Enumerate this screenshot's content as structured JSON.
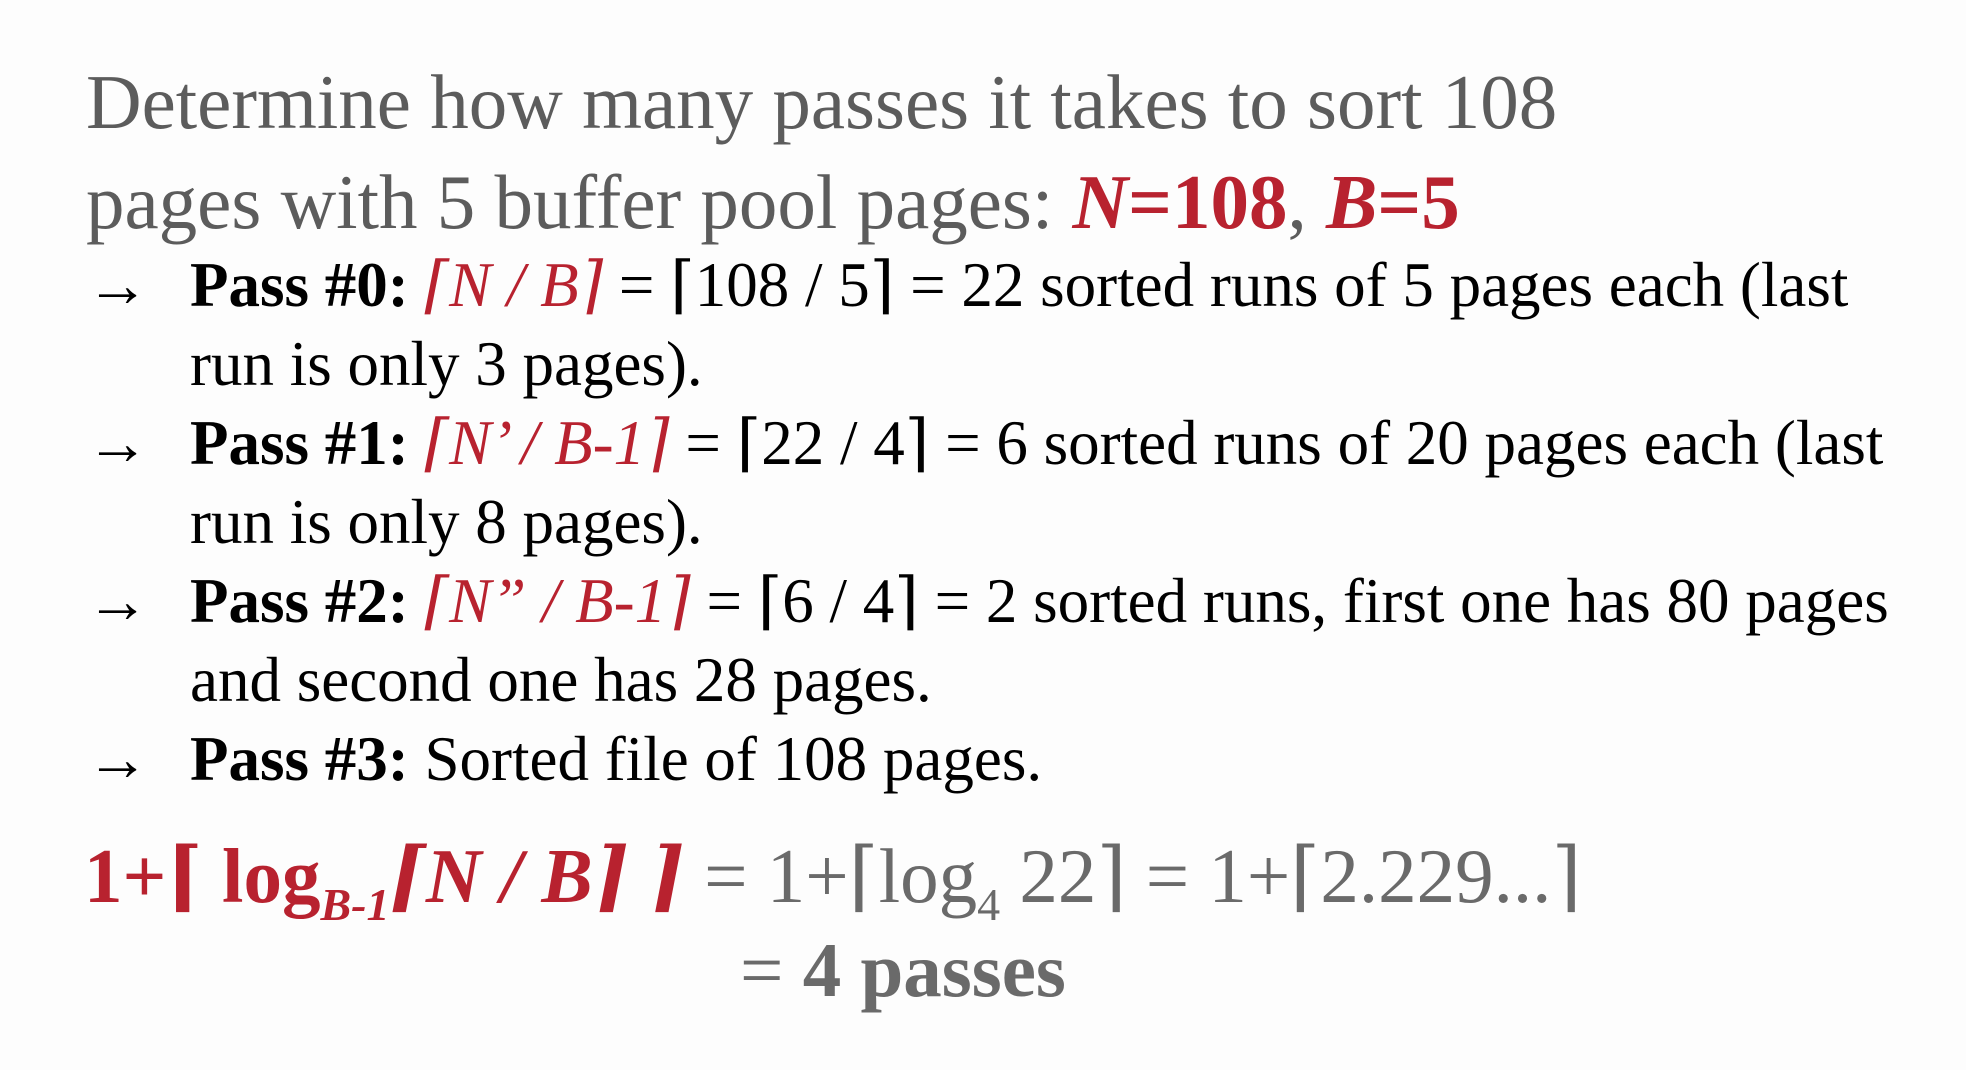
{
  "intro": {
    "line1": "Determine how many passes it takes to sort 108",
    "line2_prefix": "pages with 5 buffer pool pages: ",
    "n_label": "N",
    "n_value": "=108",
    "comma": ", ",
    "b_label": "B",
    "b_value": "=5"
  },
  "passes": [
    {
      "arrow": "→",
      "label": "Pass #0:",
      "formula": "⌈N / B⌉",
      "rest": " = ⌈108 / 5⌉ = 22 sorted runs of 5 pages each (last run is only 3 pages)."
    },
    {
      "arrow": "→",
      "label": "Pass #1:",
      "formula": "⌈N’ / B-1⌉",
      "rest": " = ⌈22 / 4⌉ = 6 sorted runs of 20 pages each (last run is only 8 pages)."
    },
    {
      "arrow": "→",
      "label": "Pass #2:",
      "formula": "⌈N” / B-1⌉",
      "rest": " = ⌈6 / 4⌉ = 2 sorted runs, first one has 80 pages and second one has 28 pages."
    },
    {
      "arrow": "→",
      "label": "Pass #3:",
      "formula": "",
      "rest": " Sorted file of 108 pages."
    }
  ],
  "formula": {
    "prefix": "1+⌈ log",
    "subscript": "B-1",
    "inner": "⌈N / B⌉ ⌉",
    "eval_prefix": " = 1+⌈log",
    "eval_sub": "4",
    "eval_rest": " 22⌉ = 1+⌈2.229...⌉"
  },
  "result": {
    "equals": "= ",
    "value": "4 passes"
  },
  "colors": {
    "accent": "#b8222f",
    "muted_text": "#5c5c5c",
    "body_text": "#000000"
  }
}
